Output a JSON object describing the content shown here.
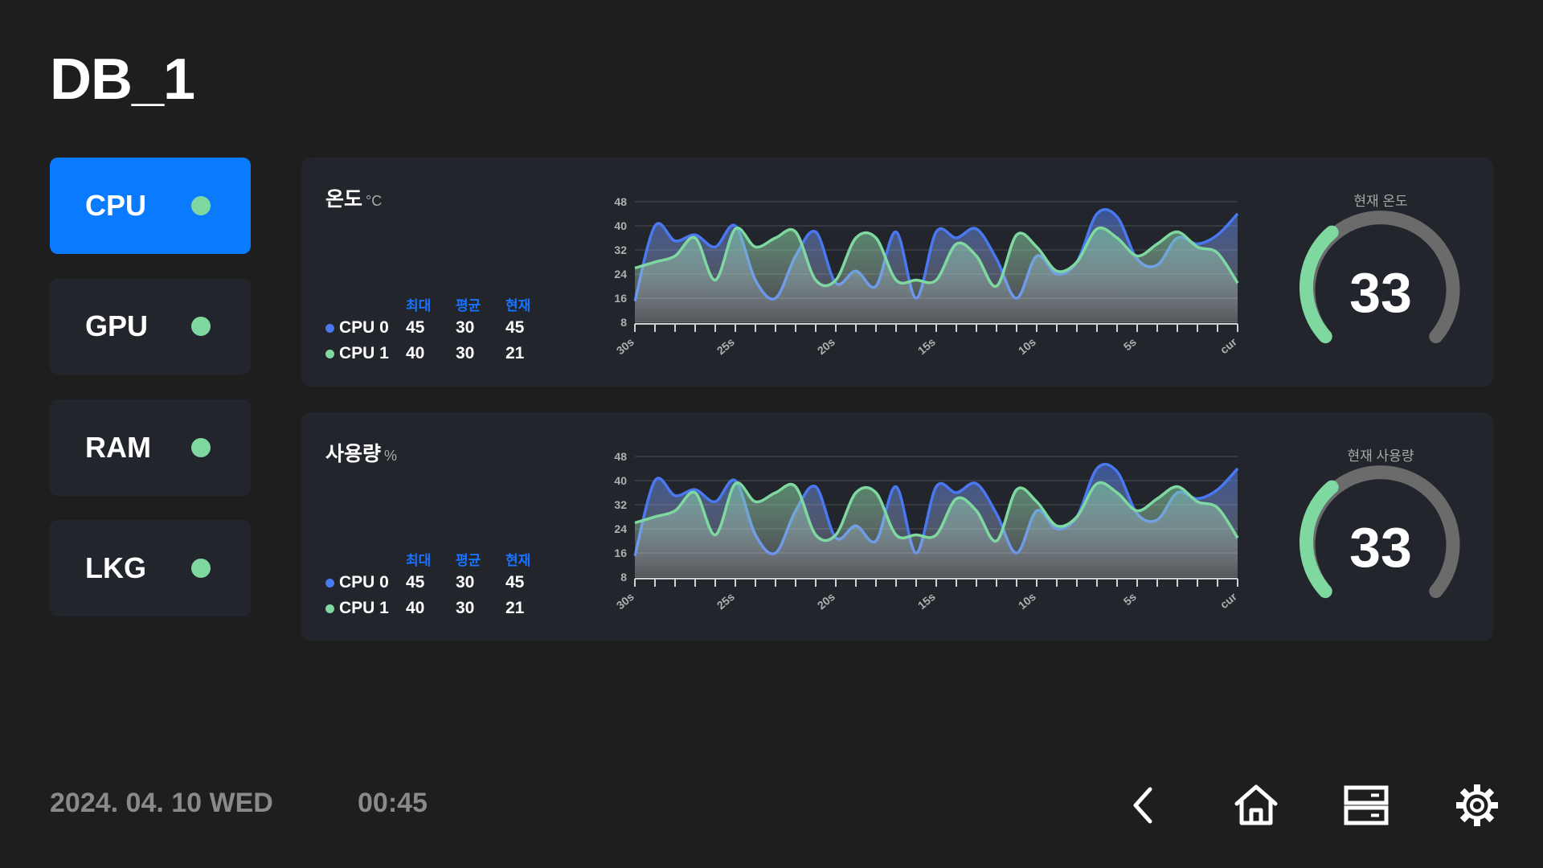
{
  "header": {
    "title": "DB_1"
  },
  "sidebar": {
    "items": [
      {
        "label": "CPU",
        "active": true
      },
      {
        "label": "GPU",
        "active": false
      },
      {
        "label": "RAM",
        "active": false
      },
      {
        "label": "LKG",
        "active": false
      }
    ]
  },
  "colors": {
    "accent": "#0a7bff",
    "cpu0": "#4a78f0",
    "cpu1": "#7fd8a0",
    "status_ok": "#7fd8a0"
  },
  "panels": [
    {
      "title": "온도",
      "unit": "°C",
      "stats": {
        "headers": [
          "최대",
          "평균",
          "현재"
        ],
        "rows": [
          {
            "name": "CPU 0",
            "max": "45",
            "avg": "30",
            "cur": "45"
          },
          {
            "name": "CPU 1",
            "max": "40",
            "avg": "30",
            "cur": "21"
          }
        ]
      },
      "gauge": {
        "label": "현재 온도",
        "value": "33"
      }
    },
    {
      "title": "사용량",
      "unit": "%",
      "stats": {
        "headers": [
          "최대",
          "평균",
          "현재"
        ],
        "rows": [
          {
            "name": "CPU 0",
            "max": "45",
            "avg": "30",
            "cur": "45"
          },
          {
            "name": "CPU 1",
            "max": "40",
            "avg": "30",
            "cur": "21"
          }
        ]
      },
      "gauge": {
        "label": "현재 사용량",
        "value": "33"
      }
    }
  ],
  "chart_data": [
    {
      "type": "area",
      "yticks": [
        "48",
        "40",
        "32",
        "24",
        "16",
        "8"
      ],
      "ylim": [
        8,
        48
      ],
      "xticks": [
        "30s",
        "25s",
        "20s",
        "15s",
        "10s",
        "5s",
        "cur"
      ],
      "x": [
        30,
        29,
        28,
        27,
        26,
        25,
        24,
        23,
        22,
        21,
        20,
        19,
        18,
        17,
        16,
        15,
        14,
        13,
        12,
        11,
        10,
        9,
        8,
        7,
        6,
        5,
        4,
        3,
        2,
        1,
        0
      ],
      "series": [
        {
          "name": "CPU 0",
          "values": [
            15,
            40,
            35,
            37,
            33,
            40,
            22,
            16,
            30,
            38,
            21,
            25,
            20,
            38,
            16,
            38,
            36,
            39,
            29,
            16,
            30,
            24,
            28,
            44,
            43,
            29,
            27,
            36,
            34,
            37,
            44
          ]
        },
        {
          "name": "CPU 1",
          "values": [
            26,
            28,
            30,
            36,
            22,
            39,
            33,
            36,
            38,
            22,
            22,
            36,
            36,
            22,
            22,
            22,
            34,
            30,
            20,
            37,
            33,
            25,
            28,
            39,
            36,
            30,
            34,
            38,
            33,
            31,
            21
          ]
        }
      ]
    },
    {
      "type": "area",
      "yticks": [
        "48",
        "40",
        "32",
        "24",
        "16",
        "8"
      ],
      "ylim": [
        8,
        48
      ],
      "xticks": [
        "30s",
        "25s",
        "20s",
        "15s",
        "10s",
        "5s",
        "cur"
      ],
      "x": [
        30,
        29,
        28,
        27,
        26,
        25,
        24,
        23,
        22,
        21,
        20,
        19,
        18,
        17,
        16,
        15,
        14,
        13,
        12,
        11,
        10,
        9,
        8,
        7,
        6,
        5,
        4,
        3,
        2,
        1,
        0
      ],
      "series": [
        {
          "name": "CPU 0",
          "values": [
            15,
            40,
            35,
            37,
            33,
            40,
            22,
            16,
            30,
            38,
            21,
            25,
            20,
            38,
            16,
            38,
            36,
            39,
            29,
            16,
            30,
            24,
            28,
            44,
            43,
            29,
            27,
            36,
            34,
            37,
            44
          ]
        },
        {
          "name": "CPU 1",
          "values": [
            26,
            28,
            30,
            36,
            22,
            39,
            33,
            36,
            38,
            22,
            22,
            36,
            36,
            22,
            22,
            22,
            34,
            30,
            20,
            37,
            33,
            25,
            28,
            39,
            36,
            30,
            34,
            38,
            33,
            31,
            21
          ]
        }
      ]
    }
  ],
  "footer": {
    "date": "2024. 04. 10 WED",
    "time": "00:45",
    "nav_icons": [
      "back-icon",
      "home-icon",
      "server-icon",
      "gear-icon"
    ]
  }
}
